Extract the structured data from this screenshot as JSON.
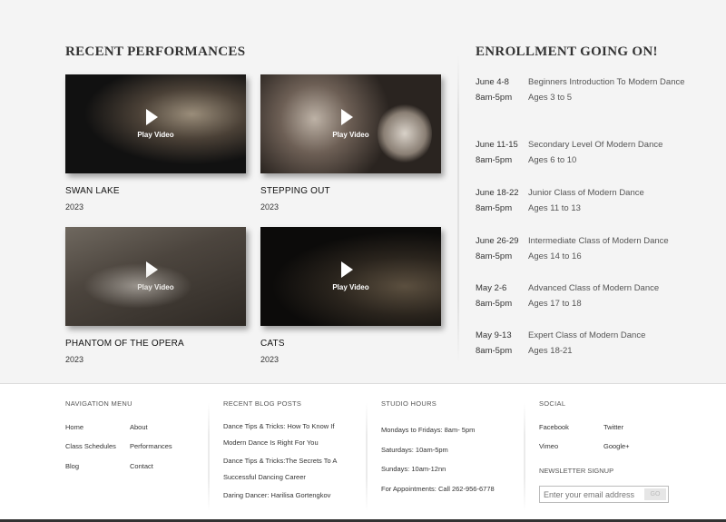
{
  "performances": {
    "title": "RECENT PERFORMANCES",
    "play_label": "Play Video",
    "items": [
      {
        "name": "SWAN LAKE",
        "year": "2023"
      },
      {
        "name": "STEPPING OUT",
        "year": "2023"
      },
      {
        "name": "PHANTOM OF THE OPERA",
        "year": "2023"
      },
      {
        "name": "CATS",
        "year": "2023"
      }
    ]
  },
  "enrollment": {
    "title": "ENROLLMENT GOING ON!",
    "items": [
      {
        "date": "June 4-8",
        "time": "8am-5pm",
        "class": "Beginners Introduction To Modern Dance",
        "ages": "Ages 3 to 5"
      },
      {
        "date": "June 11-15",
        "time": "8am-5pm",
        "class": "Secondary Level Of Modern Dance",
        "ages": "Ages 6 to 10"
      },
      {
        "date": "June 18-22",
        "time": "8am-5pm",
        "class": "Junior Class of Modern Dance",
        "ages": "Ages 11 to 13"
      },
      {
        "date": "June 26-29",
        "time": "8am-5pm",
        "class": "Intermediate Class of Modern Dance",
        "ages": "Ages 14 to 16"
      },
      {
        "date": "May 2-6",
        "time": "8am-5pm",
        "class": "Advanced Class of Modern Dance",
        "ages": "Ages 17 to 18"
      },
      {
        "date": "May 9-13",
        "time": "8am-5pm",
        "class": "Expert Class of Modern Dance",
        "ages": "Ages 18-21"
      }
    ]
  },
  "footer": {
    "nav": {
      "title": "NAVIGATION MENU",
      "items": [
        "Home",
        "About",
        "Class Schedules",
        "Performances",
        "Blog",
        "Contact"
      ]
    },
    "blog": {
      "title": "RECENT BLOG POSTS",
      "items": [
        "Dance Tips & Tricks: How To Know If Modern Dance Is Right For You",
        "Dance Tips & Tricks:The Secrets To A Successful Dancing Career",
        "Daring Dancer: Harilisa Gortengkov"
      ]
    },
    "hours": {
      "title": "STUDIO HOURS",
      "items": [
        "Mondays to Fridays: 8am- 5pm",
        "Saturdays: 10am-5pm",
        "Sundays: 10am-12nn",
        "For Appointments: Call 262-956-6778"
      ]
    },
    "social": {
      "title": "SOCIAL",
      "items": [
        "Facebook",
        "Twitter",
        "Vimeo",
        "Google+"
      ]
    },
    "newsletter": {
      "title": "NEWSLETTER SIGNUP",
      "placeholder": "Enter your email address",
      "button": "GO"
    }
  }
}
